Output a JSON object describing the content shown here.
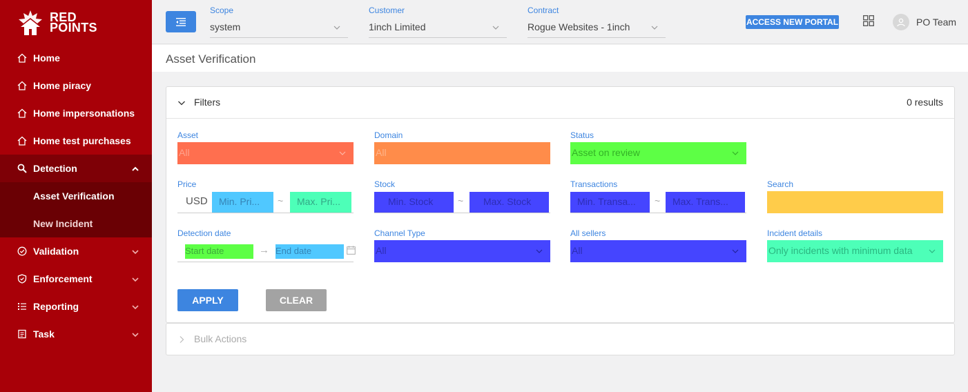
{
  "brand": {
    "line1": "RED",
    "line2": "POINTS",
    "color": "#a80008",
    "accent": "#3d85e0"
  },
  "sidebar": {
    "items": [
      {
        "label": "Home",
        "icon": "home-icon"
      },
      {
        "label": "Home piracy",
        "icon": "home-icon"
      },
      {
        "label": "Home impersonations",
        "icon": "home-icon"
      },
      {
        "label": "Home test purchases",
        "icon": "home-icon"
      },
      {
        "label": "Detection",
        "icon": "search-icon",
        "expanded": true,
        "children": [
          {
            "label": "Asset Verification",
            "active": true
          },
          {
            "label": "New Incident"
          }
        ]
      },
      {
        "label": "Validation",
        "icon": "check-circle-icon"
      },
      {
        "label": "Enforcement",
        "icon": "shield-icon"
      },
      {
        "label": "Reporting",
        "icon": "list-icon"
      },
      {
        "label": "Task",
        "icon": "task-icon"
      }
    ]
  },
  "topbar": {
    "scope": {
      "label": "Scope",
      "value": "system"
    },
    "customer": {
      "label": "Customer",
      "value": "1inch Limited"
    },
    "contract": {
      "label": "Contract",
      "value": "Rogue Websites - 1inch"
    },
    "access_button": "ACCESS NEW PORTAL",
    "user": "PO Team"
  },
  "page": {
    "title": "Asset Verification"
  },
  "filters": {
    "title": "Filters",
    "results": "0 results",
    "asset": {
      "label": "Asset",
      "placeholder": "All",
      "color": "#ff6f4f"
    },
    "domain": {
      "label": "Domain",
      "placeholder": "All",
      "color": "#ff8c4a"
    },
    "status": {
      "label": "Status",
      "value": "Asset on review",
      "color": "#5dff45"
    },
    "price": {
      "label": "Price",
      "currency": "USD",
      "min_placeholder": "Min. Pri...",
      "max_placeholder": "Max. Pri...",
      "sep": "~",
      "min_color": "#50c8ff",
      "max_color": "#4dffb8"
    },
    "stock": {
      "label": "Stock",
      "min_placeholder": "Min. Stock",
      "max_placeholder": "Max. Stock",
      "sep": "~",
      "color": "#4545ff"
    },
    "transactions": {
      "label": "Transactions",
      "min_placeholder": "Min. Transa...",
      "max_placeholder": "Max. Trans...",
      "sep": "~",
      "color": "#4545ff"
    },
    "search": {
      "label": "Search",
      "color": "#ffcc4a"
    },
    "detection_date": {
      "label": "Detection date",
      "start_placeholder": "Start date",
      "end_placeholder": "End date",
      "sep": "→",
      "start_color": "#5dff45",
      "end_color": "#50c8ff"
    },
    "channel_type": {
      "label": "Channel Type",
      "placeholder": "All",
      "color": "#4545ff"
    },
    "all_sellers": {
      "label": "All sellers",
      "placeholder": "All",
      "color": "#4545ff"
    },
    "incident_details": {
      "label": "Incident details",
      "value": "Only incidents with minimum data",
      "color": "#4dffb8"
    },
    "apply": "APPLY",
    "clear": "CLEAR"
  },
  "bulk_actions": {
    "title": "Bulk Actions"
  }
}
